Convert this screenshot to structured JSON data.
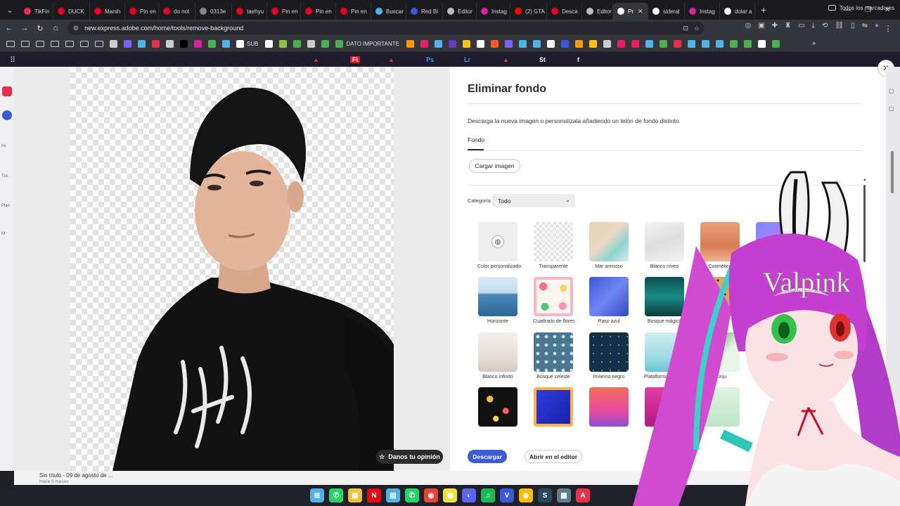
{
  "tabs": [
    {
      "label": "TikFin",
      "color": "#e8304a"
    },
    {
      "label": "DUCK",
      "color": "#e60023"
    },
    {
      "label": "Marsh",
      "color": "#e60023"
    },
    {
      "label": "Pin en",
      "color": "#e60023"
    },
    {
      "label": "do not",
      "color": "#e60023"
    },
    {
      "label": "0313e",
      "color": "#888888"
    },
    {
      "label": "taehyu",
      "color": "#e60023"
    },
    {
      "label": "Pin en",
      "color": "#e60023"
    },
    {
      "label": "Pin en",
      "color": "#e60023"
    },
    {
      "label": "Pin en",
      "color": "#e60023"
    },
    {
      "label": "Buscar",
      "color": "#4fb3e8"
    },
    {
      "label": "Red Bl",
      "color": "#3a5bd9"
    },
    {
      "label": "Editor",
      "color": "#bbbbbb"
    },
    {
      "label": "Instag",
      "color": "#d6249f"
    },
    {
      "label": "(2) GTA",
      "color": "#ff0000"
    },
    {
      "label": "Desca",
      "color": "#e60023"
    },
    {
      "label": "Editor",
      "color": "#bbbbbb"
    },
    {
      "label": "Pr",
      "color": "#ffffff",
      "active": true
    },
    {
      "label": "sideral",
      "color": "#ffffff"
    },
    {
      "label": "Instag",
      "color": "#d6249f"
    },
    {
      "label": "dolar a",
      "color": "#ffffff"
    }
  ],
  "address": {
    "url": "new.express.adobe.com/home/tools/remove-background"
  },
  "bookmarks": {
    "items": [
      {
        "label": "",
        "color": "folder"
      },
      {
        "label": "",
        "color": "folder"
      },
      {
        "label": "",
        "color": "folder"
      },
      {
        "label": "",
        "color": "folder"
      },
      {
        "label": "",
        "color": "folder"
      },
      {
        "label": "",
        "color": "folder"
      },
      {
        "label": "",
        "color": "folder"
      },
      {
        "label": "",
        "color": "#cccccc"
      },
      {
        "label": "",
        "color": "#7b61ff"
      },
      {
        "label": "",
        "color": "#4fb3e8"
      },
      {
        "label": "",
        "color": "#e8304a"
      },
      {
        "label": "",
        "color": "#cccccc"
      },
      {
        "label": "",
        "color": "#000000"
      },
      {
        "label": "",
        "color": "#d6249f"
      },
      {
        "label": "",
        "color": "#4caf50"
      },
      {
        "label": "",
        "color": "#4fb3e8"
      },
      {
        "label": "SUB",
        "color": "#ffffff"
      },
      {
        "label": "",
        "color": "#ffffff"
      },
      {
        "label": "",
        "color": "#8bc34a"
      },
      {
        "label": "",
        "color": "#4caf50"
      },
      {
        "label": "",
        "color": "#cccccc"
      },
      {
        "label": "",
        "color": "#4caf50"
      },
      {
        "label": "DATO IMPORTANTE",
        "color": "#4caf50"
      },
      {
        "label": "",
        "color": "#ff9800"
      },
      {
        "label": "",
        "color": "#e91e63"
      },
      {
        "label": "",
        "color": "#4fb3e8"
      },
      {
        "label": "",
        "color": "#673ab7"
      },
      {
        "label": "",
        "color": "#ffc107"
      },
      {
        "label": "",
        "color": "#ffffff"
      },
      {
        "label": "",
        "color": "#ff5722"
      },
      {
        "label": "",
        "color": "#7b61ff"
      },
      {
        "label": "",
        "color": "#4fb3e8"
      },
      {
        "label": "",
        "color": "#4fb3e8"
      },
      {
        "label": "",
        "color": "#ffffff"
      },
      {
        "label": "",
        "color": "#3a5bd9"
      },
      {
        "label": "",
        "color": "#ff9800"
      },
      {
        "label": "",
        "color": "#ffc107"
      },
      {
        "label": "",
        "color": "#cccccc"
      },
      {
        "label": "",
        "color": "#e91e63"
      },
      {
        "label": "",
        "color": "#e91e63"
      },
      {
        "label": "",
        "color": "#4fb3e8"
      },
      {
        "label": "",
        "color": "#4caf50"
      },
      {
        "label": "",
        "color": "#e8304a"
      },
      {
        "label": "",
        "color": "#4fb3e8"
      },
      {
        "label": "",
        "color": "#4fb3e8"
      },
      {
        "label": "",
        "color": "#4fb3e8"
      },
      {
        "label": "",
        "color": "#4caf50"
      },
      {
        "label": "",
        "color": "#4caf50"
      },
      {
        "label": "",
        "color": "#ffffff"
      },
      {
        "label": "",
        "color": "#4caf50"
      }
    ],
    "all_label": "Todos los marcadores"
  },
  "appbar": {
    "apps": [
      {
        "label": "",
        "color": "#e8304a"
      },
      {
        "label": "Fi",
        "color": "#ffffff",
        "bg": "#d4202a"
      },
      {
        "label": "",
        "color": "#e8304a"
      },
      {
        "label": "Ps",
        "color": "#31a8ff"
      },
      {
        "label": "Lr",
        "color": "#31a8ff"
      },
      {
        "label": "",
        "color": "#e8304a"
      },
      {
        "label": "St",
        "color": "#ffffff"
      },
      {
        "label": "f",
        "color": "#ffffff"
      }
    ]
  },
  "leftnav": {
    "items": [
      "Ini",
      "Tus",
      "Plan",
      "M"
    ]
  },
  "preview": {
    "feedback_label": "Danos tu opinión"
  },
  "panel": {
    "title": "Eliminar fondo",
    "subtitle": "Descarga la nueva imagen o personalízala añadiendo un telón de fondo distinto.",
    "tab": "Fondo",
    "upload_label": "Cargar imagen",
    "category_label": "Categoría",
    "category_value": "Todo",
    "backgrounds": [
      {
        "label": "Color personalizado",
        "kind": "custom"
      },
      {
        "label": "Transparente",
        "kind": "transparent"
      },
      {
        "label": "Mar arenoso",
        "kind": "sand"
      },
      {
        "label": "Blanco níveo",
        "kind": "snow"
      },
      {
        "label": "Cosmético",
        "kind": "cosmetic"
      },
      {
        "label": "",
        "kind": "gradient-blue"
      },
      {
        "label": "Horizonte",
        "kind": "horizon"
      },
      {
        "label": "Cuadrado de flores",
        "kind": "flowers"
      },
      {
        "label": "Raso azul",
        "kind": "satin"
      },
      {
        "label": "Bosque mágico",
        "kind": "forest"
      },
      {
        "label": "",
        "kind": "leopard"
      },
      {
        "label": "Blanco infinito",
        "kind": "white"
      },
      {
        "label": "Bosque celeste",
        "kind": "pine"
      },
      {
        "label": "Invierno negro",
        "kind": "winter"
      },
      {
        "label": "Plataforma v azulad",
        "kind": "platform"
      },
      {
        "label": "Conju",
        "kind": "plants"
      },
      {
        "label": "",
        "kind": "bokeh"
      },
      {
        "label": "",
        "kind": "frame"
      },
      {
        "label": "",
        "kind": "sunset"
      },
      {
        "label": "",
        "kind": "magenta"
      },
      {
        "label": "",
        "kind": "green"
      }
    ],
    "download_label": "Descargar",
    "editor_label": "Abrir en el editor"
  },
  "under": {
    "doc_title": "Sin título - 09 de agosto de ...",
    "doc_sub": "Hace 5 meses"
  },
  "overlay": {
    "text": "Valpink"
  },
  "taskbar": {
    "apps": [
      {
        "name": "windows",
        "color": "#4fb3e8",
        "glyph": "⊞"
      },
      {
        "name": "whatsapp-badge",
        "color": "#25d366",
        "glyph": "✆"
      },
      {
        "name": "explorer",
        "color": "#f3c13a",
        "glyph": "▣"
      },
      {
        "name": "netflix",
        "color": "#e50914",
        "glyph": "N"
      },
      {
        "name": "files",
        "color": "#4fb3e8",
        "glyph": "▤"
      },
      {
        "name": "whatsapp",
        "color": "#25d366",
        "glyph": "✆"
      },
      {
        "name": "chrome",
        "color": "#ea4335",
        "glyph": "◉"
      },
      {
        "name": "notes",
        "color": "#f3e23a",
        "glyph": "▦"
      },
      {
        "name": "discord",
        "color": "#5865f2",
        "glyph": "◐"
      },
      {
        "name": "spotify",
        "color": "#1db954",
        "glyph": "♫"
      },
      {
        "name": "vtube",
        "color": "#3a5bd9",
        "glyph": "V"
      },
      {
        "name": "chrome2",
        "color": "#fbbc05",
        "glyph": "◉"
      },
      {
        "name": "steam",
        "color": "#2a475e",
        "glyph": "S"
      },
      {
        "name": "app",
        "color": "#607d8b",
        "glyph": "▩"
      },
      {
        "name": "adobe",
        "color": "#e8304a",
        "glyph": "A"
      }
    ]
  }
}
